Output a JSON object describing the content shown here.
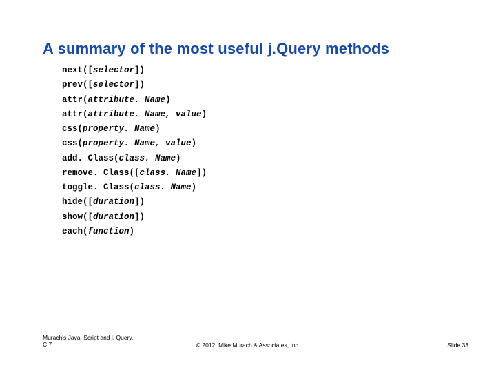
{
  "title": "A summary of the most useful j.Query methods",
  "methods": [
    {
      "name": "next",
      "open": "([",
      "param": "selector",
      "close": "])"
    },
    {
      "name": "prev",
      "open": "([",
      "param": "selector",
      "close": "])"
    },
    {
      "name": "attr",
      "open": "(",
      "param": "attribute. Name",
      "close": ")"
    },
    {
      "name": "attr",
      "open": "(",
      "param": "attribute. Name, value",
      "close": ")"
    },
    {
      "name": "css",
      "open": "(",
      "param": "property. Name",
      "close": ")"
    },
    {
      "name": "css",
      "open": "(",
      "param": "property. Name, value",
      "close": ")"
    },
    {
      "name": "add. Class",
      "open": "(",
      "param": "class. Name",
      "close": ")"
    },
    {
      "name": "remove. Class",
      "open": "([",
      "param": "class. Name",
      "close": "])"
    },
    {
      "name": "toggle. Class",
      "open": "(",
      "param": "class. Name",
      "close": ")"
    },
    {
      "name": "hide",
      "open": "([",
      "param": "duration",
      "close": "])"
    },
    {
      "name": "show",
      "open": "([",
      "param": "duration",
      "close": "])"
    },
    {
      "name": "each",
      "open": "(",
      "param": "function",
      "close": ")"
    }
  ],
  "footer": {
    "left_line1": "Murach's Java. Script and j. Query,",
    "left_line2": "C 7",
    "center": "© 2012, Mike Murach & Associates, Inc.",
    "right": "Slide 33"
  }
}
